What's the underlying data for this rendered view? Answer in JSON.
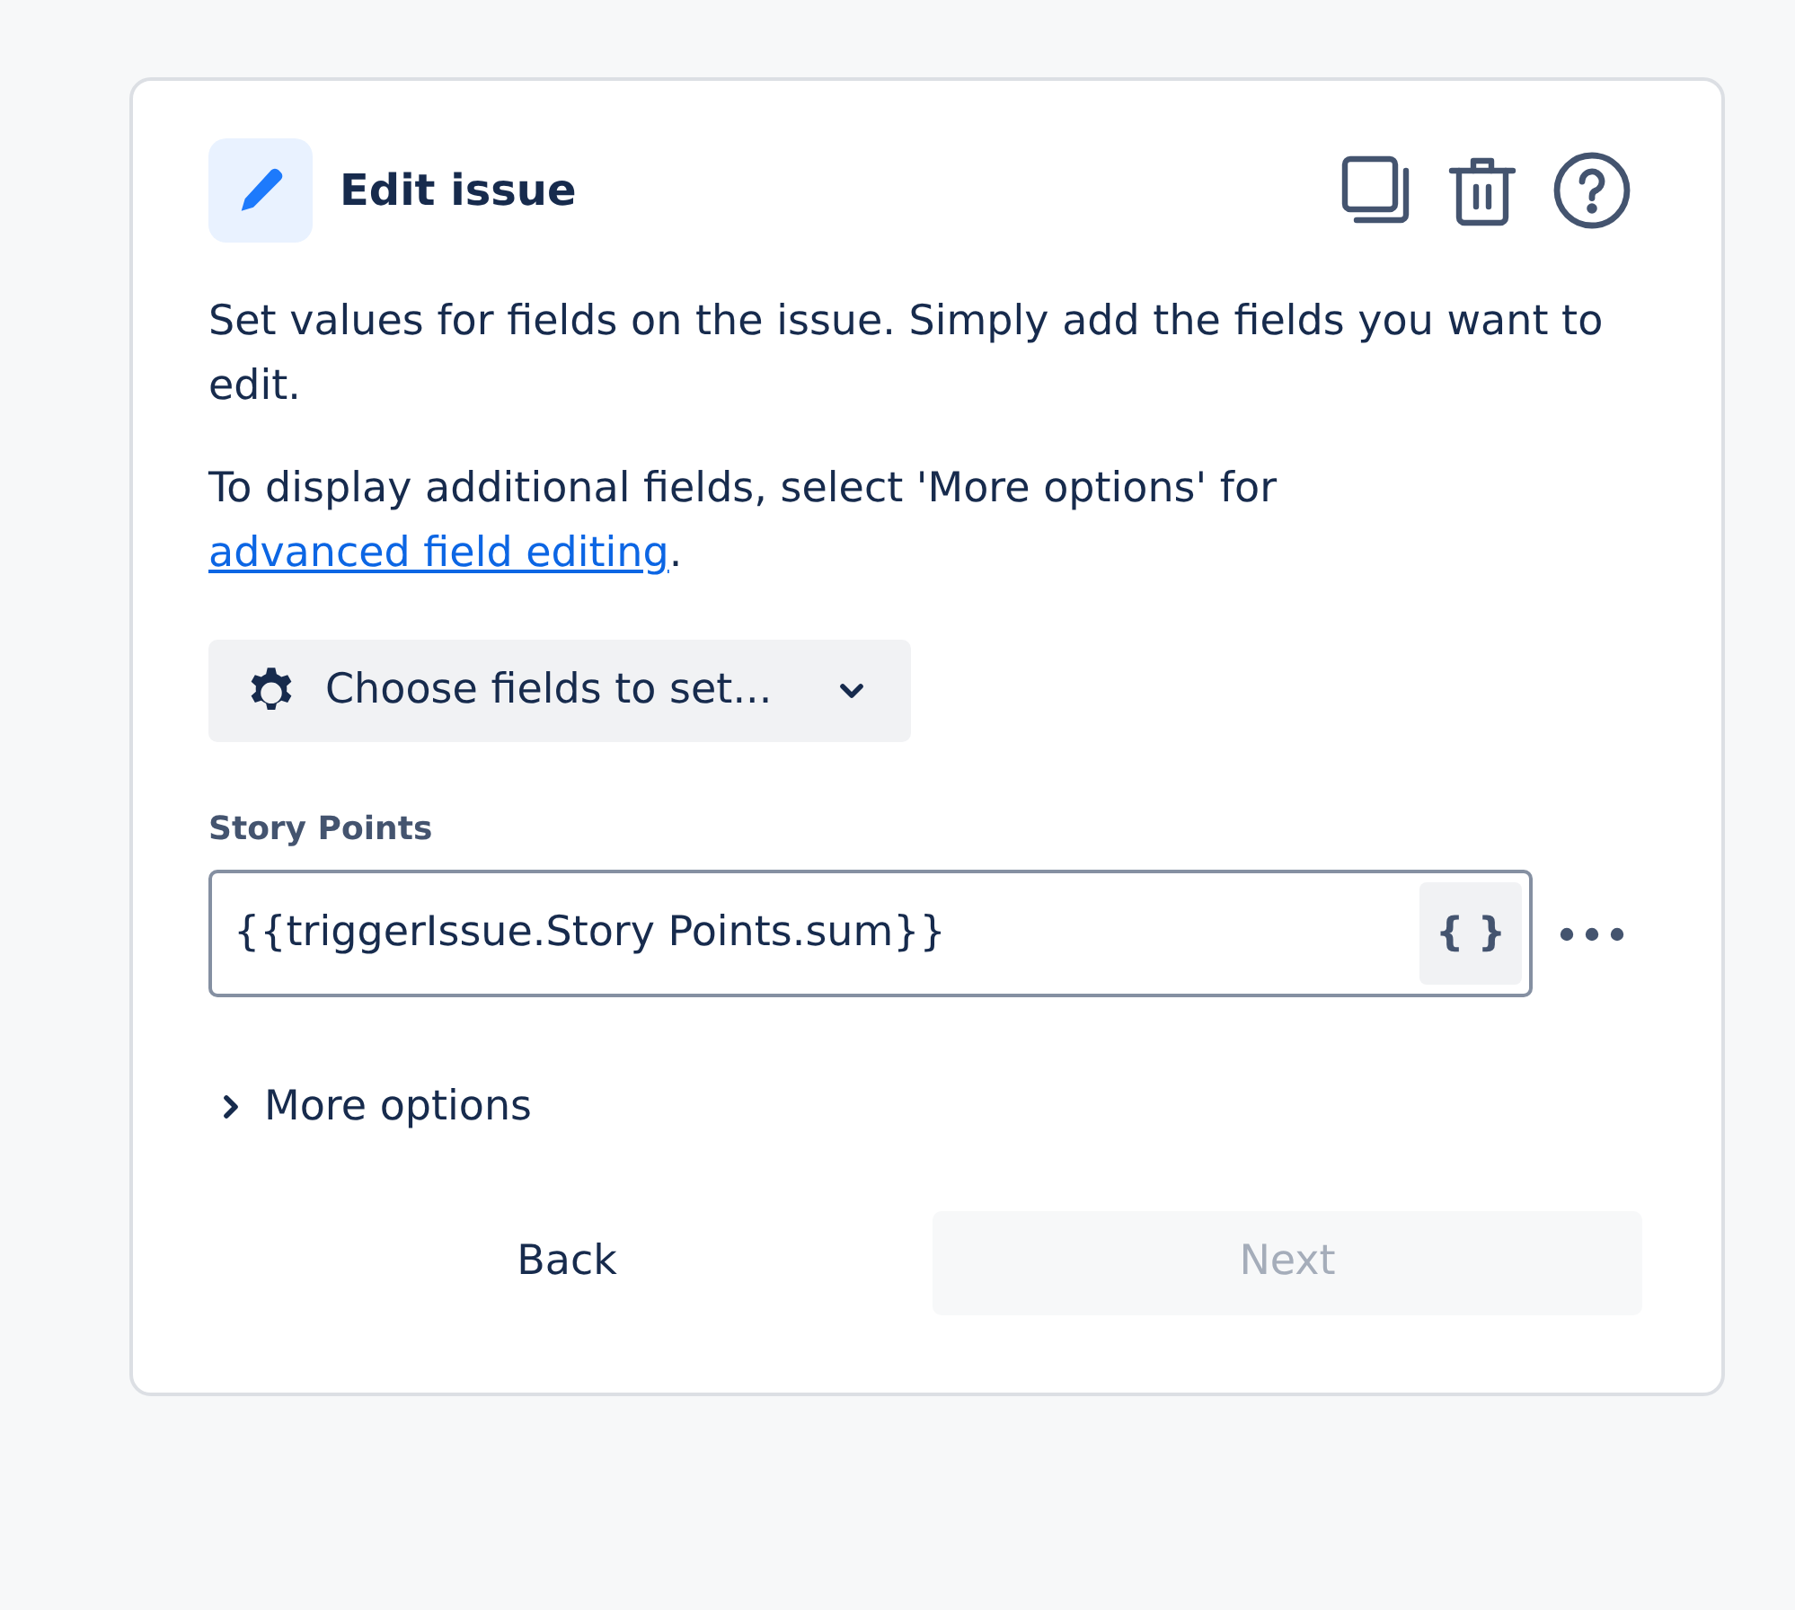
{
  "header": {
    "title": "Edit issue"
  },
  "paragraphs": [
    {
      "text": "Set values for fields on the issue. Simply add the fields you want to edit."
    },
    {
      "text": "To display additional fields, select 'More options' for ",
      "link": "advanced field editing",
      "after": "."
    }
  ],
  "field_picker": {
    "label": "Choose fields to set..."
  },
  "fields": [
    {
      "label": "Story Points",
      "value": "{{triggerIssue.Story Points.sum}}",
      "smart_value_button": "{ }"
    }
  ],
  "more_options": {
    "label": "More options",
    "expanded": false
  },
  "buttons": [
    {
      "label": "Back",
      "kind": "subtle",
      "disabled": false
    },
    {
      "label": "Next",
      "kind": "primary",
      "disabled": true
    }
  ]
}
